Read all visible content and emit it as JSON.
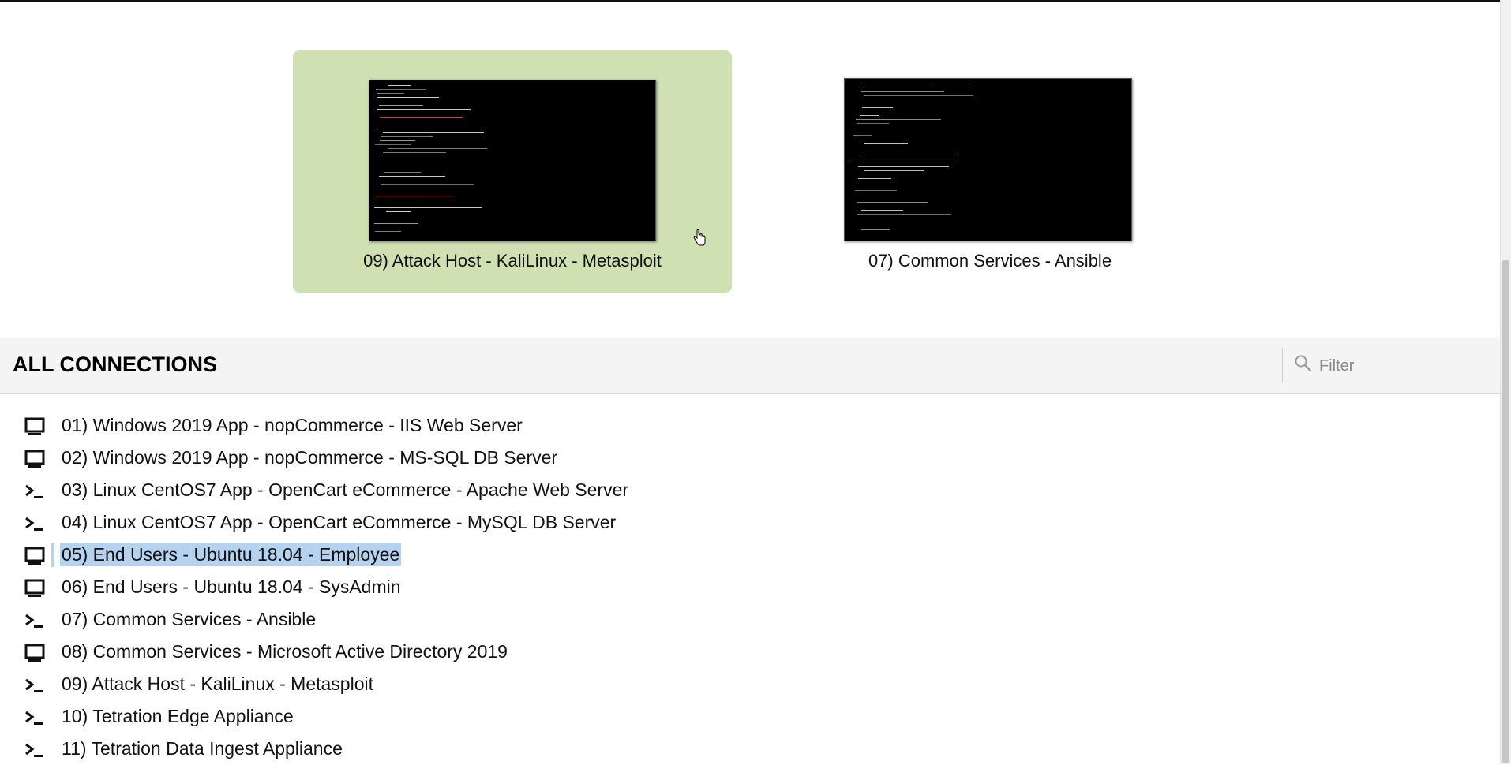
{
  "recent": [
    {
      "label": "09) Attack Host - KaliLinux - Metasploit",
      "active": true,
      "thumbnail_icon": "terminal-screenshot"
    },
    {
      "label": "07) Common Services - Ansible",
      "active": false,
      "thumbnail_icon": "terminal-screenshot"
    }
  ],
  "all_connections": {
    "title": "ALL CONNECTIONS",
    "filter_placeholder": "Filter",
    "items": [
      {
        "label": "01) Windows 2019 App - nopCommerce - IIS Web Server",
        "icon": "desktop-icon"
      },
      {
        "label": "02) Windows 2019 App - nopCommerce - MS-SQL DB Server",
        "icon": "desktop-icon"
      },
      {
        "label": "03) Linux CentOS7 App - OpenCart eCommerce - Apache Web Server",
        "icon": "terminal-icon"
      },
      {
        "label": "04) Linux CentOS7 App - OpenCart eCommerce - MySQL DB Server",
        "icon": "terminal-icon"
      },
      {
        "label": "05) End Users - Ubuntu 18.04 - Employee",
        "icon": "desktop-icon",
        "selected": true
      },
      {
        "label": "06) End Users - Ubuntu 18.04 - SysAdmin",
        "icon": "desktop-icon"
      },
      {
        "label": "07) Common Services - Ansible",
        "icon": "terminal-icon"
      },
      {
        "label": "08) Common Services - Microsoft Active Directory 2019",
        "icon": "desktop-icon"
      },
      {
        "label": "09) Attack Host - KaliLinux - Metasploit",
        "icon": "terminal-icon"
      },
      {
        "label": "10) Tetration Edge Appliance",
        "icon": "terminal-icon"
      },
      {
        "label": "11) Tetration Data Ingest Appliance",
        "icon": "terminal-icon"
      }
    ]
  },
  "colors": {
    "active_tile": "#cfe0b3",
    "selection": "#b5d2ee",
    "header_bg": "#f4f4f4"
  }
}
